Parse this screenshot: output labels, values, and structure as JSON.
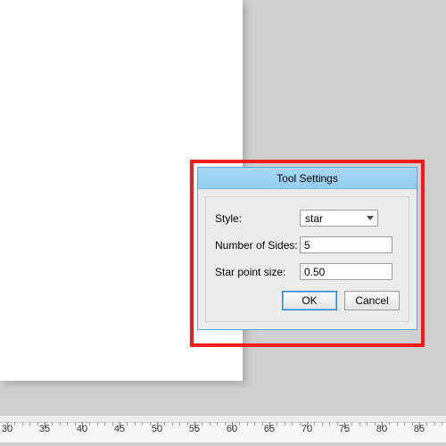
{
  "dialog": {
    "title": "Tool Settings",
    "style": {
      "label": "Style:",
      "value": "star"
    },
    "sides": {
      "label": "Number of Sides:",
      "value": "5"
    },
    "point_size": {
      "label": "Star point size:",
      "value": "0.50"
    },
    "buttons": {
      "ok": "OK",
      "cancel": "Cancel"
    }
  },
  "ruler": {
    "labels": [
      "30",
      "35",
      "40",
      "45",
      "50",
      "55",
      "60",
      "65",
      "70",
      "75",
      "80",
      "85"
    ]
  },
  "colors": {
    "highlight": "#ef1c1c",
    "titlebar": "#93cdf2"
  }
}
